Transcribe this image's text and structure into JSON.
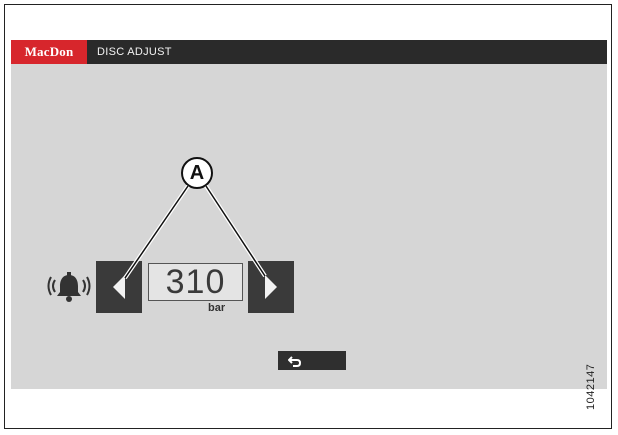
{
  "header": {
    "brand": "MacDon",
    "title": "DISC ADJUST",
    "brand_color": "#d7262c"
  },
  "control": {
    "alarm_icon": "alarm-bell-icon",
    "decrease_icon": "chevron-left-icon",
    "increase_icon": "chevron-right-icon",
    "value": "310",
    "unit": "bar"
  },
  "footer": {
    "back_icon": "return-arrow-icon"
  },
  "annotation": {
    "callout": "A",
    "figure_id": "1042147"
  }
}
